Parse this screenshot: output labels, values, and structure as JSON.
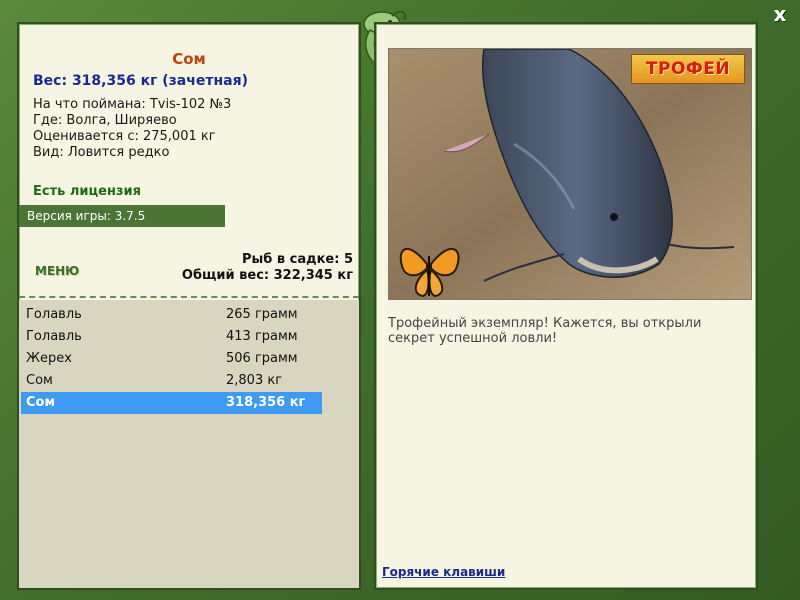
{
  "fish": {
    "name": "Сом",
    "weight": "Вес: 318,356 кг (зачетная)",
    "bait": "На что поймана: Tvis-102 №3",
    "location": "Где: Волга, Ширяево",
    "score_from": "Оценивается с: 275,001 кг",
    "rarity": "Вид: Ловится редко"
  },
  "license": "Есть лицензия",
  "version": "Версия игры: 3.7.5",
  "menu_label": "МЕНЮ",
  "cage": {
    "count": "Рыб в садке: 5",
    "total": "Общий вес: 322,345 кг"
  },
  "catch_list": [
    {
      "name": "Голавль",
      "weight": "265 грамм"
    },
    {
      "name": "Голавль",
      "weight": "413 грамм"
    },
    {
      "name": "Жерех",
      "weight": "506 грамм"
    },
    {
      "name": "Сом",
      "weight": "2,803 кг"
    },
    {
      "name": "Сом",
      "weight": "318,356 кг"
    }
  ],
  "trophy_badge": "ТРОФЕЙ",
  "description": "Трофейный экземпляр! Кажется, вы открыли секрет успешной ловли!",
  "hotkeys_link": "Горячие клавиши",
  "close_label": "x",
  "colors": {
    "frame": "#426e2c",
    "panel": "#f6f4e2",
    "fish_name": "#c0420e",
    "weight_text": "#1b2a8c",
    "license_text": "#1b6a18",
    "selected_row": "#3f9bf2"
  }
}
